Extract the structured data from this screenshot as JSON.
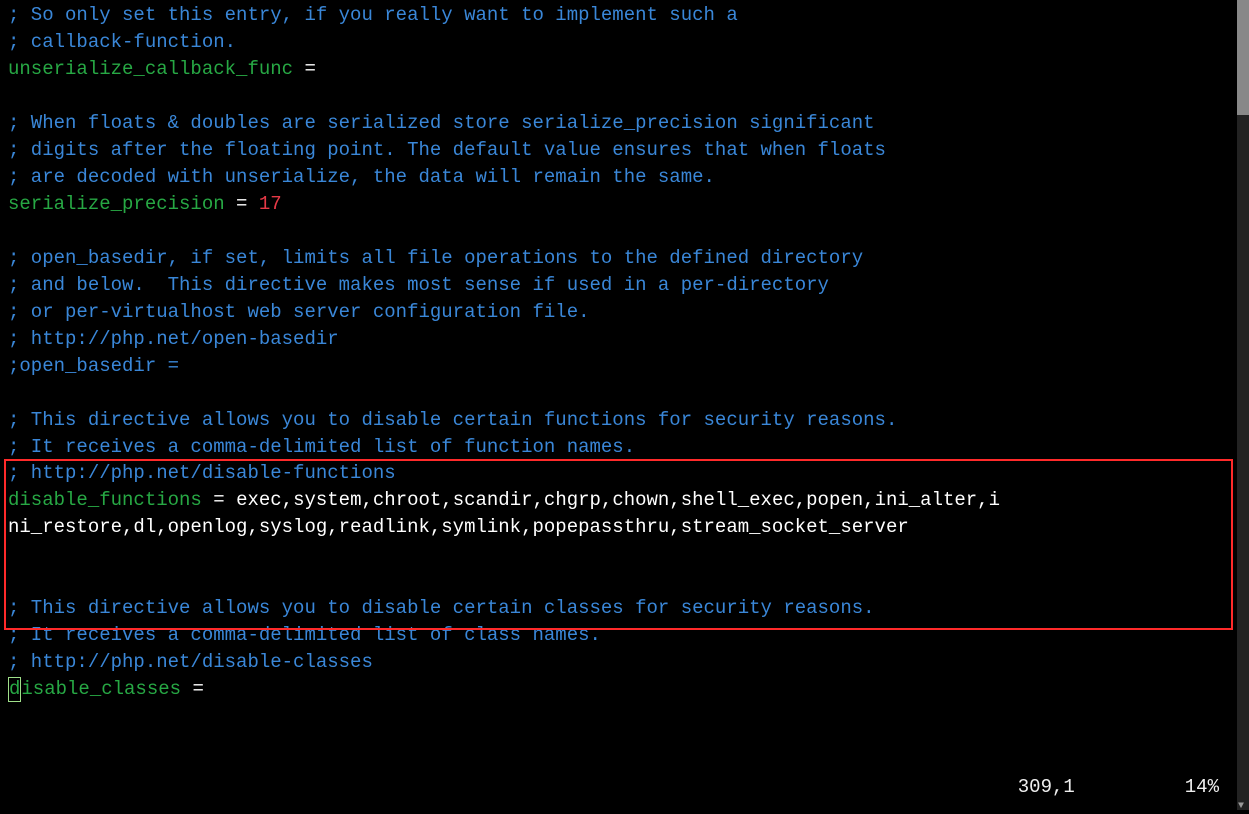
{
  "lines": {
    "c1": "; So only set this entry, if you really want to implement such a",
    "c2": "; callback-function.",
    "k3": "unserialize_callback_func",
    "e3": " =",
    "c5": "; When floats & doubles are serialized store serialize_precision significant",
    "c6": "; digits after the floating point. The default value ensures that when floats",
    "c7": "; are decoded with unserialize, the data will remain the same.",
    "k8": "serialize_precision",
    "e8": " = ",
    "v8": "17",
    "c10": "; open_basedir, if set, limits all file operations to the defined directory",
    "c11": "; and below.  This directive makes most sense if used in a per-directory",
    "c12": "; or per-virtualhost web server configuration file.",
    "c13": "; http://php.net/open-basedir",
    "c14": ";open_basedir =",
    "c16": "; This directive allows you to disable certain functions for security reasons.",
    "c17": "; It receives a comma-delimited list of function names.",
    "c18": "; http://php.net/disable-functions",
    "k19": "disable_functions",
    "e19": " = ",
    "v19a": "exec,system,chroot,scandir,chgrp,chown,shell_exec,popen,ini_alter,i",
    "v19b": "ni_restore,dl,openlog,syslog,readlink,symlink,popepassthru,stream_socket_server",
    "c22": "; This directive allows you to disable certain classes for security reasons.",
    "c23": "; It receives a comma-delimited list of class names.",
    "c24": "; http://php.net/disable-classes",
    "k25a": "d",
    "k25b": "isable_classes",
    "e25": " ="
  },
  "status": {
    "pos": "309,1",
    "pct": "14%"
  }
}
